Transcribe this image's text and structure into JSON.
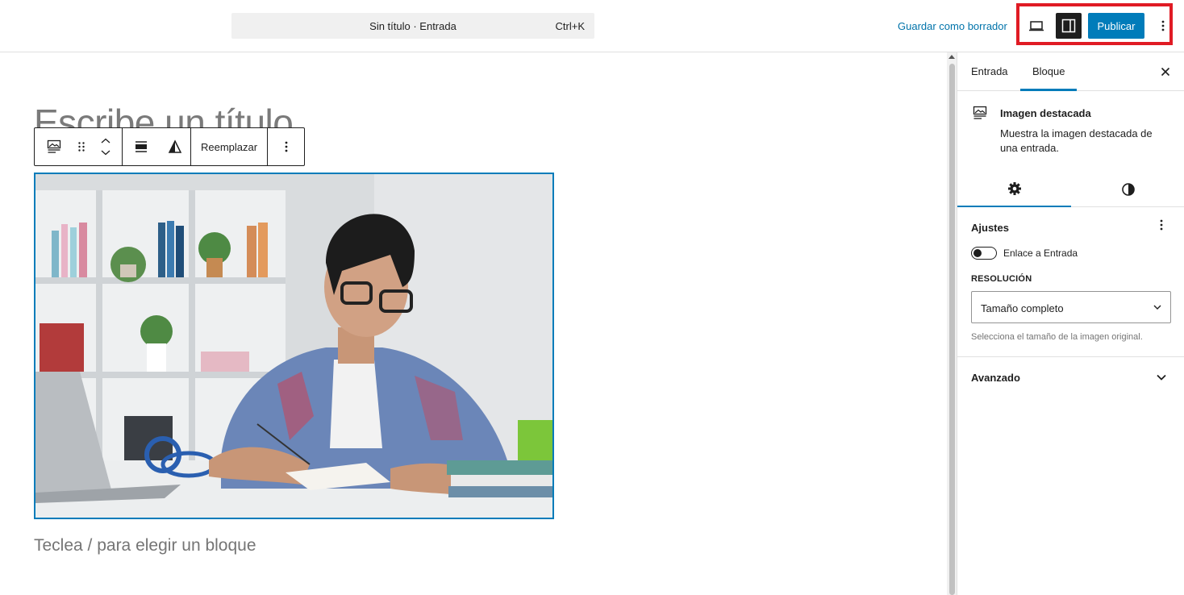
{
  "topbar": {
    "command_title": "Sin título · Entrada",
    "command_shortcut": "Ctrl+K",
    "save_draft": "Guardar como borrador",
    "publish": "Publicar"
  },
  "editor": {
    "title_placeholder": "Escribe un título",
    "toolbar_replace": "Reemplazar",
    "block_hint": "Teclea / para elegir un bloque"
  },
  "sidebar": {
    "tabs": [
      {
        "label": "Entrada"
      },
      {
        "label": "Bloque",
        "active": true
      }
    ],
    "block_card": {
      "title": "Imagen destacada",
      "description": "Muestra la imagen destacada de una entrada."
    },
    "settings": {
      "panel_title": "Ajustes",
      "link_toggle_label": "Enlace a Entrada",
      "link_toggle_on": false,
      "resolution_label": "RESOLUCIÓN",
      "resolution_value": "Tamaño completo",
      "resolution_help": "Selecciona el tamaño de la imagen original."
    },
    "advanced_label": "Avanzado"
  },
  "colors": {
    "accent": "#007cba",
    "highlight_box": "#e01b24",
    "dark": "#1e1e1e"
  }
}
